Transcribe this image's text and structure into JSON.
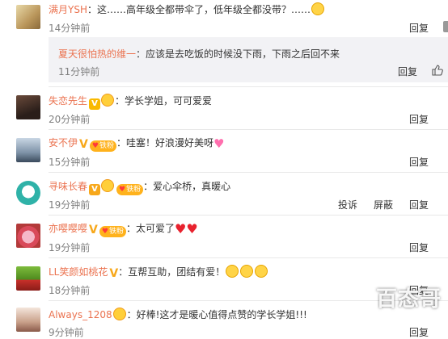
{
  "comments": [
    {
      "user": "满月YSH",
      "sep": "：",
      "text": "这……高年级全都带伞了，低年级全都没带？……",
      "time": "14分钟前",
      "actions": [
        "回复"
      ]
    },
    {
      "user": "失恋先生",
      "sep": "：",
      "text": "学长学姐，可可爱爱",
      "time": "20分钟前",
      "actions": [
        "回复"
      ]
    },
    {
      "user": "安不伊",
      "sep": "：",
      "text": "哇塞！好浪漫好美呀",
      "time": "15分钟前",
      "actions": [
        "回复"
      ]
    },
    {
      "user": "寻味长春",
      "sep": "：",
      "text": "爱心伞桥，真暖心",
      "time": "19分钟前",
      "actions": [
        "投诉",
        "屏蔽",
        "回复"
      ]
    },
    {
      "user": "亦嘤嘤嘤",
      "sep": "：",
      "text": "太可爱了",
      "time": "19分钟前",
      "actions": [
        "回复"
      ]
    },
    {
      "user": "LL笑颜如桃花",
      "sep": "：",
      "text": "互帮互助，团结有爱！",
      "time": "18分钟前",
      "actions": [
        "回复"
      ]
    },
    {
      "user": "Always_1208",
      "sep": "：",
      "text": "好棒!这才是暖心值得点赞的学长学姐!!!",
      "time": "9分钟前",
      "actions": [
        "回复"
      ]
    }
  ],
  "reply": {
    "user": "夏天很怕热的维一",
    "sep": "：",
    "text": "应该是去吃饭的时候没下雨，下雨之后回不来",
    "time": "11分钟前",
    "action": "回复"
  },
  "badges": {
    "v": "V",
    "fan": "铁粉"
  },
  "watermark": "百态哥",
  "colors": {
    "username": "#eb7350",
    "reply_bg": "#f2f2f5"
  }
}
